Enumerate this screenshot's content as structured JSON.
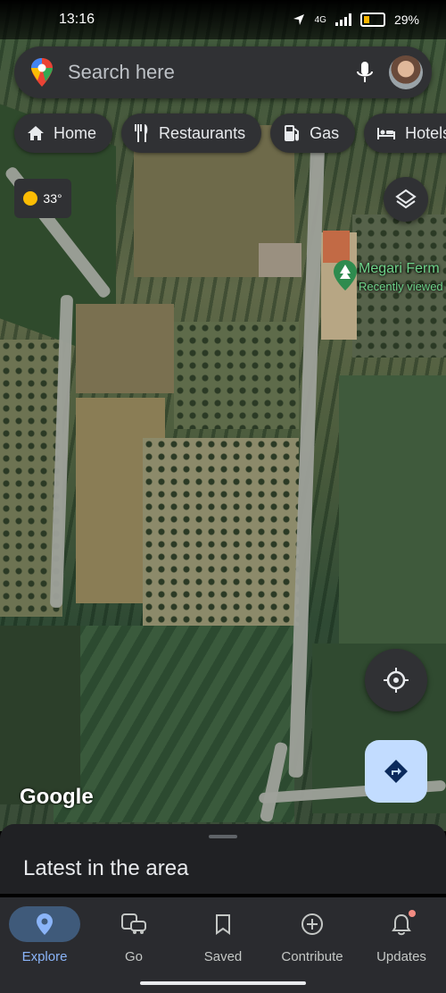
{
  "status_bar": {
    "time": "13:16",
    "network": "4G",
    "battery": "29%"
  },
  "search": {
    "placeholder": "Search here"
  },
  "chips": [
    {
      "label": "Home",
      "icon": "home-icon"
    },
    {
      "label": "Restaurants",
      "icon": "restaurant-icon"
    },
    {
      "label": "Gas",
      "icon": "gas-station-icon"
    },
    {
      "label": "Hotels",
      "icon": "hotel-icon"
    }
  ],
  "weather": {
    "temperature": "33°",
    "icon": "sun-icon"
  },
  "place": {
    "name": "Megari Ferm",
    "subtitle": "Recently viewed"
  },
  "map": {
    "attribution": "Google",
    "type": "satellite"
  },
  "sheet": {
    "title": "Latest in the area"
  },
  "nav": {
    "items": [
      {
        "label": "Explore",
        "icon": "location-pin-icon",
        "active": true
      },
      {
        "label": "Go",
        "icon": "commute-icon",
        "active": false
      },
      {
        "label": "Saved",
        "icon": "bookmark-icon",
        "active": false
      },
      {
        "label": "Contribute",
        "icon": "add-circle-icon",
        "active": false
      },
      {
        "label": "Updates",
        "icon": "bell-icon",
        "active": false,
        "badge": true
      }
    ]
  },
  "colors": {
    "accent": "#8ab4f8",
    "surface": "#303134",
    "fab": "#c2dcff",
    "place_green": "#6fd38a"
  }
}
